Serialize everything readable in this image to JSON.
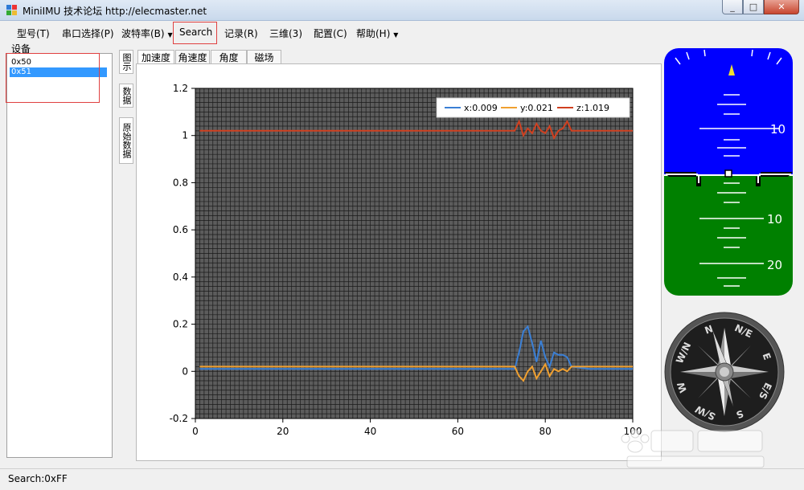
{
  "window": {
    "title": "MiniIMU 技术论坛 http://elecmaster.net",
    "buttons": [
      "_",
      "□",
      "✕"
    ]
  },
  "menu": [
    {
      "label": "型号(T)",
      "dropdown": false
    },
    {
      "label": "串口选择(P)",
      "dropdown": false
    },
    {
      "label": "波特率(B)",
      "dropdown": true
    },
    {
      "label": "Search",
      "dropdown": false
    },
    {
      "label": "记录(R)",
      "dropdown": false
    },
    {
      "label": "三维(3)",
      "dropdown": false
    },
    {
      "label": "配置(C)",
      "dropdown": false
    },
    {
      "label": "帮助(H)",
      "dropdown": true
    }
  ],
  "devices": {
    "label": "设备",
    "items": [
      "0x50",
      "0x51"
    ],
    "selected_index": 1
  },
  "vertical_tabs": [
    "图示",
    "数据",
    "原始数据"
  ],
  "tabs": [
    "加速度",
    "角速度",
    "角度",
    "磁场"
  ],
  "active_tab": 0,
  "chart_data": {
    "type": "line",
    "title": "",
    "xlabel": "",
    "ylabel": "",
    "xlim": [
      0,
      100
    ],
    "ylim": [
      -0.2,
      1.2
    ],
    "x_ticks": [
      "0",
      "20",
      "40",
      "60",
      "80",
      "100"
    ],
    "y_ticks": [
      "1.2",
      "1",
      "0.8",
      "0.6",
      "0.4",
      "0.2",
      "0",
      "-0.2"
    ],
    "grid": true,
    "legend_position": "top-right",
    "legend": [
      "x:0.009",
      "y:0.021",
      "z:1.019"
    ],
    "series": [
      {
        "name": "x:0.009",
        "color": "#3a7fd5",
        "x": [
          1,
          10,
          20,
          30,
          40,
          50,
          60,
          70,
          73,
          74,
          75,
          76,
          77,
          78,
          79,
          80,
          81,
          82,
          83,
          84,
          85,
          86,
          90,
          95,
          100
        ],
        "y": [
          0.01,
          0.01,
          0.01,
          0.01,
          0.01,
          0.01,
          0.01,
          0.01,
          0.01,
          0.08,
          0.17,
          0.19,
          0.12,
          0.04,
          0.13,
          0.06,
          0.02,
          0.08,
          0.07,
          0.07,
          0.06,
          0.02,
          0.01,
          0.01,
          0.01
        ]
      },
      {
        "name": "y:0.021",
        "color": "#f0a030",
        "x": [
          1,
          10,
          20,
          30,
          40,
          50,
          60,
          70,
          73,
          74,
          75,
          76,
          77,
          78,
          79,
          80,
          81,
          82,
          83,
          84,
          85,
          86,
          90,
          95,
          100
        ],
        "y": [
          0.02,
          0.02,
          0.02,
          0.02,
          0.02,
          0.02,
          0.02,
          0.02,
          0.02,
          -0.02,
          -0.04,
          0.0,
          0.02,
          -0.03,
          0.0,
          0.03,
          -0.02,
          0.01,
          0.0,
          0.01,
          0.0,
          0.02,
          0.02,
          0.02,
          0.02
        ]
      },
      {
        "name": "z:1.019",
        "color": "#d04020",
        "x": [
          1,
          10,
          20,
          30,
          40,
          50,
          60,
          70,
          73,
          74,
          75,
          76,
          77,
          78,
          79,
          80,
          81,
          82,
          83,
          84,
          85,
          86,
          90,
          95,
          100
        ],
        "y": [
          1.02,
          1.02,
          1.02,
          1.02,
          1.02,
          1.02,
          1.02,
          1.02,
          1.02,
          1.06,
          1.0,
          1.03,
          1.01,
          1.05,
          1.02,
          1.01,
          1.04,
          0.99,
          1.02,
          1.03,
          1.06,
          1.02,
          1.02,
          1.02,
          1.02
        ]
      }
    ]
  },
  "attitude": {
    "marks": [
      "10",
      "10",
      "20"
    ],
    "sky_color": "#0000ff",
    "ground_color": "#008000"
  },
  "compass": {
    "labels": [
      "N",
      "N/E",
      "E",
      "E/S",
      "S",
      "S/W",
      "W",
      "W/N"
    ]
  },
  "status": {
    "text": "Search:0xFF"
  }
}
